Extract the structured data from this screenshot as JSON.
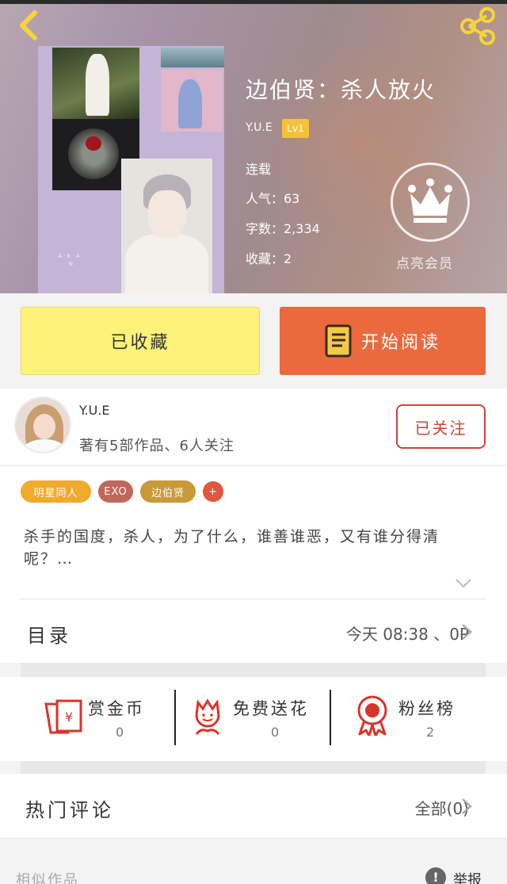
{
  "icons": {
    "back": "chevron-left-icon",
    "share": "share-icon",
    "crown": "crown-icon",
    "book": "book-icon",
    "red_envelope": "red-envelope-icon",
    "flower": "flower-icon",
    "ribbon": "award-ribbon-icon",
    "report": "exclamation-icon"
  },
  "colors": {
    "read_button": "#ea6a3d",
    "collect_button": "#fff27a",
    "follow_border": "#c8453a",
    "reward_icon": "#d9342b",
    "level_badge": "#f3c13a"
  },
  "book": {
    "title": "边伯贤：杀人放火",
    "author": "Y.U.E",
    "level": "Lv1",
    "status": "连载",
    "popularity": "人气：63",
    "word_count": "字数：2,334",
    "favorites": "收藏：2",
    "member_label": "点亮会员"
  },
  "cover": {
    "mark": "A · K · A · N"
  },
  "actions": {
    "collected_label": "已收藏",
    "read_label": "开始阅读"
  },
  "author": {
    "name": "Y.U.E",
    "stats": "著有5部作品、6人关注",
    "follow_label": "已关注"
  },
  "tags": [
    "明星同人",
    "EXO",
    "边伯贤",
    "+"
  ],
  "description": "杀手的国度，杀人，为了什么，谁善谁恶，又有谁分得清呢？…",
  "toc": {
    "label": "目录",
    "update": "今天 08:38 、0P"
  },
  "rewards": [
    {
      "label": "赏金币",
      "count": "0"
    },
    {
      "label": "免费送花",
      "count": "0"
    },
    {
      "label": "粉丝榜",
      "count": "2"
    }
  ],
  "comments": {
    "title": "热门评论",
    "all_label": "全部(0)"
  },
  "footer": {
    "similar_label": "相似作品",
    "report_label": "举报",
    "report_icon_glyph": "!"
  }
}
